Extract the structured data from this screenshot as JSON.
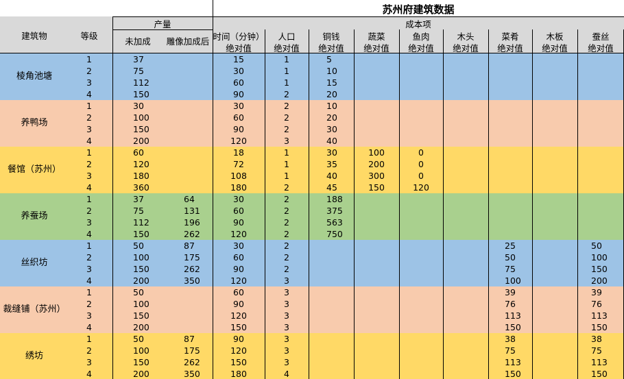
{
  "title": "苏州府建筑数据",
  "headers": {
    "building": "建筑物",
    "level": "等级",
    "output_group": "产量",
    "no_bonus": "未加成",
    "statue_bonus": "雕像加成后",
    "cost_group": "成本项",
    "time": "时间（分钟）",
    "population": "人口",
    "coins": "铜钱",
    "vegetables": "蔬菜",
    "fish_meat": "鱼肉",
    "wood": "木头",
    "dishes": "菜肴",
    "planks": "木板",
    "silk": "蚕丝",
    "absolute": "绝对值"
  },
  "colors": {
    "blue": "#9dc3e6",
    "peach": "#f8cbad",
    "yellow": "#ffd966",
    "green": "#a9d08e",
    "header_gray": "#d9d9d9"
  },
  "groups": [
    {
      "name": "棱角池塘",
      "color": "blue",
      "rows": [
        [
          "1",
          "37",
          "",
          "15",
          "1",
          "5",
          "",
          "",
          "",
          "",
          "",
          ""
        ],
        [
          "2",
          "75",
          "",
          "30",
          "1",
          "10",
          "",
          "",
          "",
          "",
          "",
          ""
        ],
        [
          "3",
          "112",
          "",
          "60",
          "1",
          "15",
          "",
          "",
          "",
          "",
          "",
          ""
        ],
        [
          "4",
          "150",
          "",
          "90",
          "2",
          "20",
          "",
          "",
          "",
          "",
          "",
          ""
        ]
      ]
    },
    {
      "name": "养鸭场",
      "color": "peach",
      "rows": [
        [
          "1",
          "30",
          "",
          "30",
          "2",
          "10",
          "",
          "",
          "",
          "",
          "",
          ""
        ],
        [
          "2",
          "100",
          "",
          "60",
          "2",
          "20",
          "",
          "",
          "",
          "",
          "",
          ""
        ],
        [
          "3",
          "150",
          "",
          "90",
          "2",
          "30",
          "",
          "",
          "",
          "",
          "",
          ""
        ],
        [
          "4",
          "200",
          "",
          "120",
          "3",
          "40",
          "",
          "",
          "",
          "",
          "",
          ""
        ]
      ]
    },
    {
      "name": "餐馆（苏州）",
      "color": "yellow",
      "rows": [
        [
          "1",
          "60",
          "",
          "18",
          "1",
          "30",
          "100",
          "0",
          "",
          "",
          "",
          ""
        ],
        [
          "2",
          "120",
          "",
          "72",
          "1",
          "35",
          "200",
          "0",
          "",
          "",
          "",
          ""
        ],
        [
          "3",
          "180",
          "",
          "108",
          "1",
          "40",
          "300",
          "0",
          "",
          "",
          "",
          ""
        ],
        [
          "4",
          "360",
          "",
          "180",
          "2",
          "45",
          "150",
          "120",
          "",
          "",
          "",
          ""
        ]
      ]
    },
    {
      "name": "养蚕场",
      "color": "green",
      "rows": [
        [
          "1",
          "37",
          "64",
          "30",
          "2",
          "188",
          "",
          "",
          "",
          "",
          "",
          ""
        ],
        [
          "2",
          "75",
          "131",
          "60",
          "2",
          "375",
          "",
          "",
          "",
          "",
          "",
          ""
        ],
        [
          "3",
          "112",
          "196",
          "90",
          "2",
          "563",
          "",
          "",
          "",
          "",
          "",
          ""
        ],
        [
          "4",
          "150",
          "262",
          "120",
          "2",
          "750",
          "",
          "",
          "",
          "",
          "",
          ""
        ]
      ]
    },
    {
      "name": "丝织坊",
      "color": "blue",
      "rows": [
        [
          "1",
          "50",
          "87",
          "30",
          "2",
          "",
          "",
          "",
          "",
          "25",
          "",
          "50"
        ],
        [
          "2",
          "100",
          "175",
          "60",
          "2",
          "",
          "",
          "",
          "",
          "50",
          "",
          "100"
        ],
        [
          "3",
          "150",
          "262",
          "90",
          "2",
          "",
          "",
          "",
          "",
          "75",
          "",
          "150"
        ],
        [
          "4",
          "200",
          "350",
          "120",
          "3",
          "",
          "",
          "",
          "",
          "100",
          "",
          "200"
        ]
      ]
    },
    {
      "name": "裁缝铺（苏州）",
      "color": "peach",
      "rows": [
        [
          "1",
          "50",
          "",
          "60",
          "3",
          "",
          "",
          "",
          "",
          "39",
          "",
          "39"
        ],
        [
          "2",
          "100",
          "",
          "90",
          "3",
          "",
          "",
          "",
          "",
          "76",
          "",
          "76"
        ],
        [
          "3",
          "150",
          "",
          "120",
          "3",
          "",
          "",
          "",
          "",
          "113",
          "",
          "113"
        ],
        [
          "4",
          "200",
          "",
          "150",
          "3",
          "",
          "",
          "",
          "",
          "150",
          "",
          "150"
        ]
      ]
    },
    {
      "name": "绣坊",
      "color": "yellow",
      "rows": [
        [
          "1",
          "50",
          "87",
          "90",
          "3",
          "",
          "",
          "",
          "",
          "38",
          "",
          "38"
        ],
        [
          "2",
          "100",
          "175",
          "120",
          "3",
          "",
          "",
          "",
          "",
          "75",
          "",
          "75"
        ],
        [
          "3",
          "150",
          "262",
          "150",
          "3",
          "",
          "",
          "",
          "",
          "113",
          "",
          "113"
        ],
        [
          "4",
          "200",
          "350",
          "180",
          "4",
          "",
          "",
          "",
          "",
          "150",
          "",
          "150"
        ]
      ]
    }
  ]
}
